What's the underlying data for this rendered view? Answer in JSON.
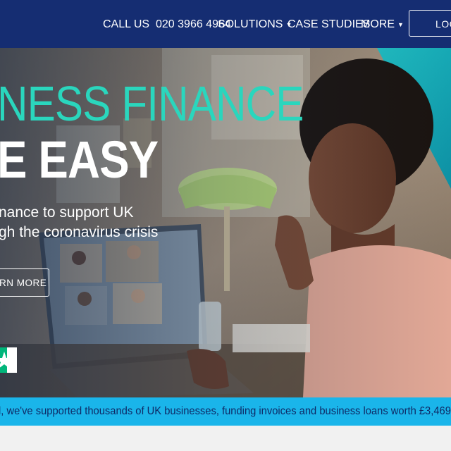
{
  "header": {
    "call_label": "CALL US",
    "phone": "020 3966 4964",
    "nav": [
      {
        "label": "SOLUTIONS",
        "has_dropdown": true
      },
      {
        "label": "CASE STUDIES",
        "has_dropdown": false
      },
      {
        "label": "MORE",
        "has_dropdown": true
      }
    ],
    "login_label": "LOG"
  },
  "hero": {
    "title_line1": "NESS FINANCE",
    "title_line2": "E EASY",
    "subtitle_line1": "nance to support UK",
    "subtitle_line2": "gh the coronavirus crisis",
    "cta_label": "RN MORE"
  },
  "ticker": {
    "text": "l, we've supported thousands of UK businesses, funding invoices and business loans worth £3,469"
  },
  "colors": {
    "header_bg": "#152d72",
    "accent_teal": "#2ad6bd",
    "ticker_bg": "#1ab5ea",
    "ticker_text": "#0f2a66"
  }
}
